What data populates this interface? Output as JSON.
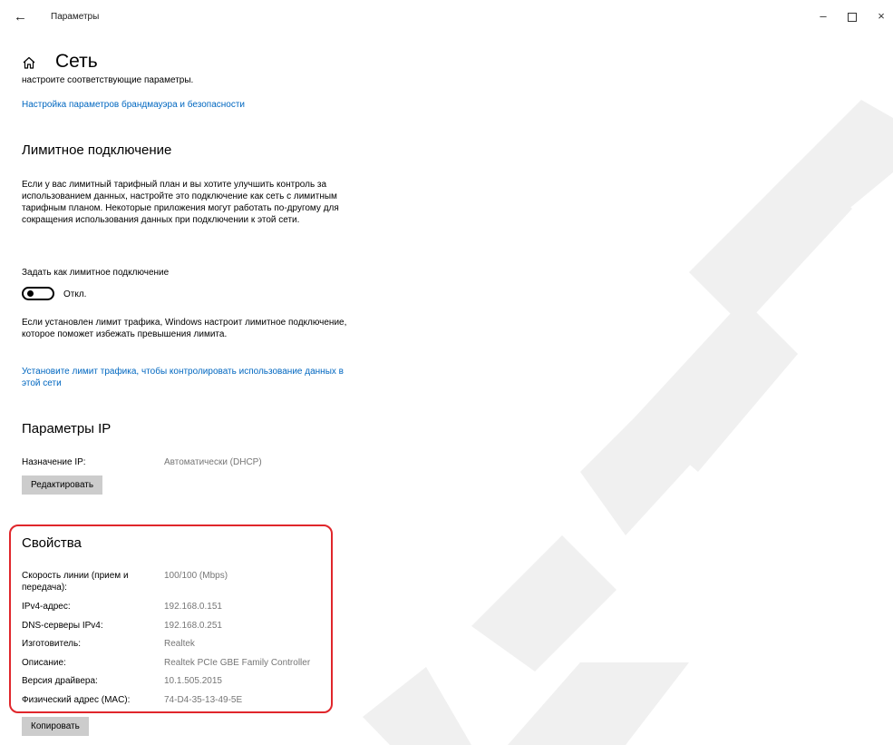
{
  "window": {
    "title": "Параметры",
    "back_icon": "←",
    "minimize_icon": "–",
    "close_icon": "×"
  },
  "page": {
    "title": "Сеть"
  },
  "top_text": "настроите соответствующие параметры.",
  "firewall_link": "Настройка параметров брандмауэра и безопасности",
  "metered": {
    "title": "Лимитное подключение",
    "description": "Если у вас лимитный тарифный план и вы хотите улучшить контроль за использованием данных, настройте это подключение как сеть с лимитным тарифным планом. Некоторые приложения могут работать по-другому для сокращения использования данных при подключении к этой сети.",
    "toggle_label": "Задать как лимитное подключение",
    "toggle_state": "Откл.",
    "toggle_on": false,
    "limit_note": "Если установлен лимит трафика, Windows настроит лимитное подключение, которое поможет избежать превышения лимита.",
    "limit_link": "Установите лимит трафика, чтобы контролировать использование данных в этой сети"
  },
  "ip": {
    "title": "Параметры IP",
    "assignment_label": "Назначение IP:",
    "assignment_value": "Автоматически (DHCP)",
    "edit_button": "Редактировать"
  },
  "properties": {
    "title": "Свойства",
    "rows": [
      {
        "label": "Скорость линии (прием и передача):",
        "value": "100/100 (Mbps)"
      },
      {
        "label": "IPv4-адрес:",
        "value": "192.168.0.151"
      },
      {
        "label": "DNS-серверы IPv4:",
        "value": "192.168.0.251"
      },
      {
        "label": "Изготовитель:",
        "value": "Realtek"
      },
      {
        "label": "Описание:",
        "value": "Realtek PCIe GBE Family Controller"
      },
      {
        "label": "Версия драйвера:",
        "value": "10.1.505.2015"
      },
      {
        "label": "Физический адрес (MAC):",
        "value": "74-D4-35-13-49-5E"
      }
    ],
    "copy_button": "Копировать"
  },
  "colors": {
    "link": "#0067c0",
    "highlight": "#e0262b",
    "button_bg": "#cccccc",
    "value_text": "#767676",
    "watermark": "#f0f0f0"
  }
}
